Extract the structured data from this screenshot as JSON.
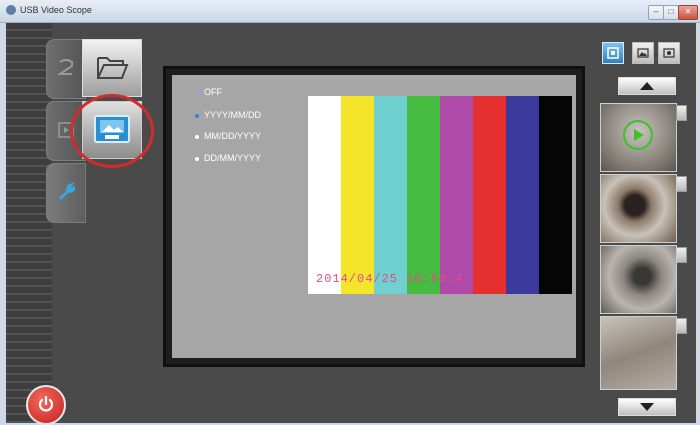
{
  "window": {
    "title": "USB Video Scope",
    "minimize_label": "–",
    "maximize_label": "□",
    "close_label": "✕"
  },
  "sidebar": {
    "tabs": [
      {
        "icon": "camera-mode-icon"
      },
      {
        "icon": "playback-mode-icon"
      },
      {
        "icon": "settings-wrench-icon"
      }
    ],
    "buttons": [
      {
        "icon": "folder-open-icon"
      },
      {
        "icon": "date-stamp-icon"
      }
    ]
  },
  "date_format": {
    "options": [
      "OFF",
      "YYYY/MM/DD",
      "MM/DD/YYYY",
      "DD/MM/YYYY"
    ],
    "selected": "YYYY/MM/DD"
  },
  "preview": {
    "bars": [
      "#ffffff",
      "#f5e52a",
      "#6fd0cf",
      "#45bb3f",
      "#b04aa8",
      "#e63030",
      "#3b3b9d",
      "#050505"
    ],
    "date_stamp": "2014/04/25 10:53:4"
  },
  "right_panel": {
    "mode_buttons": [
      "capture-mode-icon",
      "photo-mode-icon",
      "video-mode-icon"
    ],
    "thumbnails": [
      {
        "type": "video",
        "icon": "play-icon"
      },
      {
        "type": "photo"
      },
      {
        "type": "photo"
      },
      {
        "type": "photo"
      }
    ]
  },
  "colors": {
    "accent": "#3b7fd6",
    "highlight_circle": "#d12c2c",
    "power": "#d9302a"
  }
}
